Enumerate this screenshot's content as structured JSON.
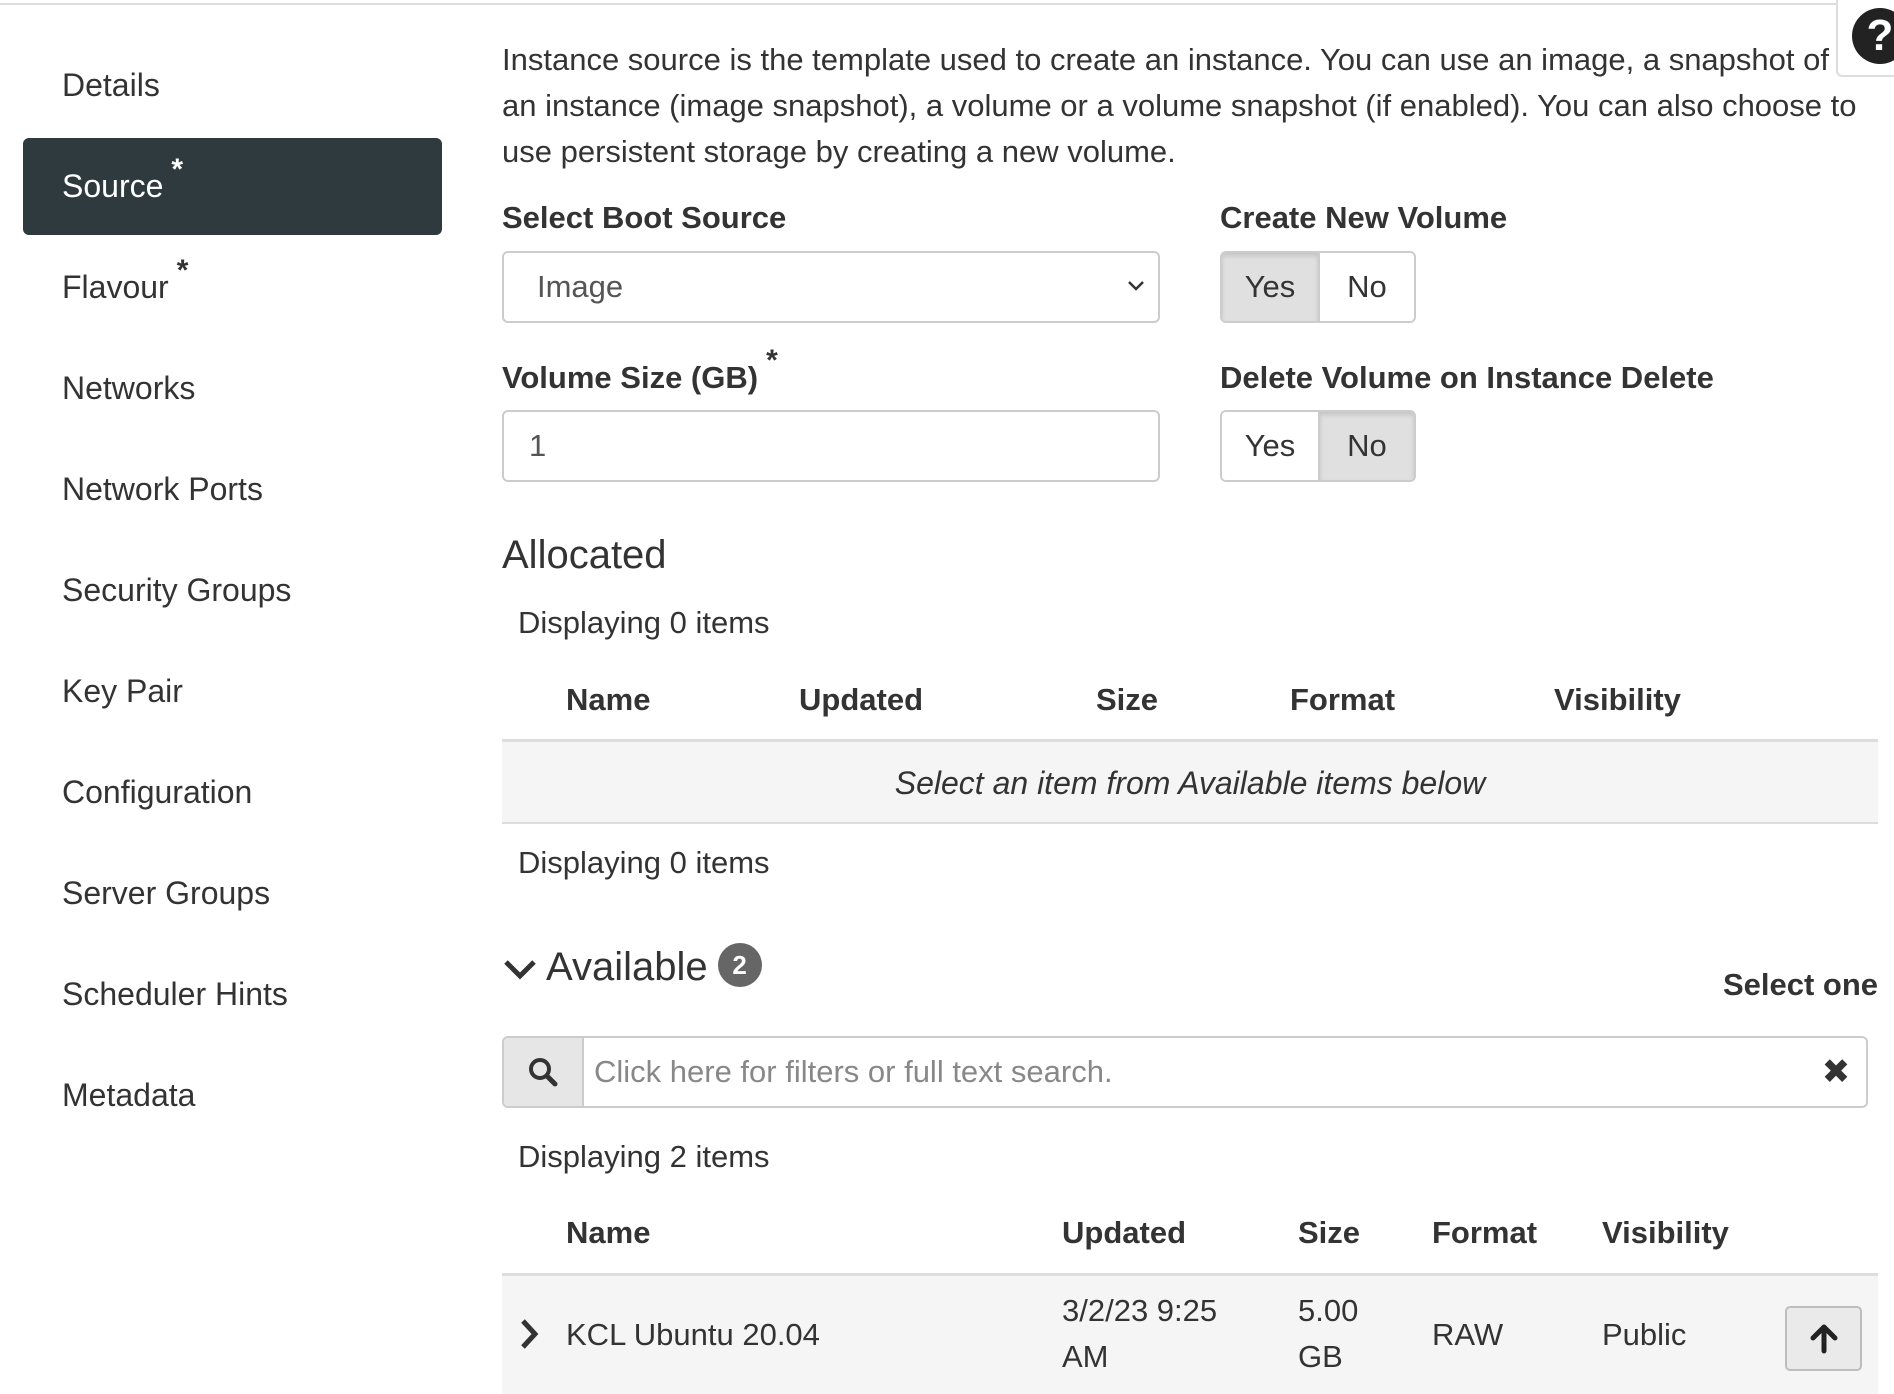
{
  "sidebar": {
    "items": [
      {
        "label": "Details",
        "required": ""
      },
      {
        "label": "Source",
        "required": "*"
      },
      {
        "label": "Flavour",
        "required": "*"
      },
      {
        "label": "Networks",
        "required": ""
      },
      {
        "label": "Network Ports",
        "required": ""
      },
      {
        "label": "Security Groups",
        "required": ""
      },
      {
        "label": "Key Pair",
        "required": ""
      },
      {
        "label": "Configuration",
        "required": ""
      },
      {
        "label": "Server Groups",
        "required": ""
      },
      {
        "label": "Scheduler Hints",
        "required": ""
      },
      {
        "label": "Metadata",
        "required": ""
      }
    ],
    "active_index": 1
  },
  "help": {
    "glyph": "?"
  },
  "intro_text": "Instance source is the template used to create an instance. You can use an image, a snapshot of an instance (image snapshot), a volume or a volume snapshot (if enabled). You can also choose to use persistent storage by creating a new volume.",
  "boot_source": {
    "label": "Select Boot Source",
    "value": "Image"
  },
  "create_volume": {
    "label": "Create New Volume",
    "yes": "Yes",
    "no": "No",
    "selected": "Yes"
  },
  "volume_size": {
    "label": "Volume Size (GB)",
    "required": "*",
    "value": "1"
  },
  "delete_volume": {
    "label": "Delete Volume on Instance Delete",
    "yes": "Yes",
    "no": "No",
    "selected": "No"
  },
  "allocated": {
    "title": "Allocated",
    "count_top": "Displaying 0 items",
    "count_bottom": "Displaying 0 items",
    "columns": [
      "Name",
      "Updated",
      "Size",
      "Format",
      "Visibility"
    ],
    "empty_message": "Select an item from Available items below"
  },
  "available": {
    "title": "Available",
    "badge": "2",
    "select_hint": "Select one",
    "search_placeholder": "Click here for filters or full text search.",
    "clear_glyph": "✖",
    "count": "Displaying 2 items",
    "columns": [
      "Name",
      "Updated",
      "Size",
      "Format",
      "Visibility"
    ],
    "rows": [
      {
        "name": "KCL Ubuntu 20.04",
        "updated_line1": "3/2/23 9:25",
        "updated_line2": "AM",
        "size_line1": "5.00",
        "size_line2": "GB",
        "format": "RAW",
        "visibility": "Public"
      }
    ]
  }
}
